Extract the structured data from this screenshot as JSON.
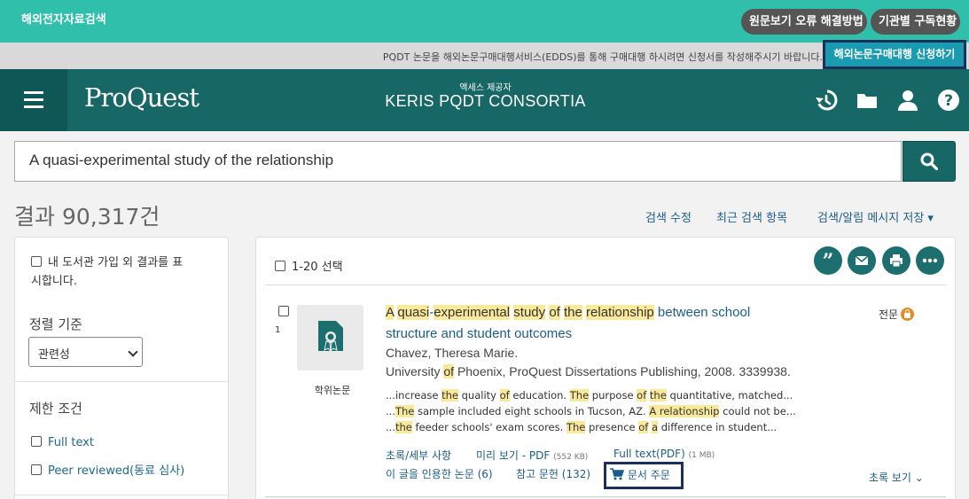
{
  "topbar": {
    "site_title": "해외전자자료검색",
    "pill_error": "원문보기 오류 해결방법",
    "pill_subscription": "기관별 구독현황"
  },
  "notice": {
    "text": "PQDT 논문을 해외논문구매대행서비스(EDDS)를 통해 구매대행 하시려면 신청서를 작성해주시기 바랍니다.",
    "order_button": "해외논문구매대행 신청하기"
  },
  "header": {
    "logo": "ProQuest",
    "provider_label": "액세스 제공자",
    "provider_name": "KERIS PQDT CONSORTIA",
    "icons": [
      "history-icon",
      "folder-icon",
      "user-icon",
      "help-icon"
    ]
  },
  "search": {
    "query": "A quasi-experimental study of the relationship"
  },
  "results": {
    "count": "결과 90,317건",
    "links": [
      "검색 수정",
      "최근 검색 항목",
      "검색/알림 메시지 저장 ▾"
    ]
  },
  "left": {
    "include_outside": "내 도서관 가입 외 결과를 표시합니다.",
    "include_outside_line1": "내 도서관 가입 외 결과를 표",
    "include_outside_line2": "시합니다.",
    "sort_label": "정렬 기준",
    "sort_value": "관련성",
    "limit_label": "제한 조건",
    "filters": [
      "Full text",
      "Peer reviewed(동료 심사)"
    ]
  },
  "list": {
    "select_label": "1-20 선택",
    "actions": [
      "cite-icon",
      "email-icon",
      "print-icon",
      "more-icon"
    ]
  },
  "item": {
    "number": "1",
    "type_label": "학위논문",
    "title_rest_line1": "between school",
    "title_line2": "structure and student outcomes",
    "author": "Chavez, Theresa Marie.",
    "pub_pre": "University",
    "pub_of": "of",
    "pub_post": "Phoenix, ProQuest Dissertations Publishing, 2008. 3339938.",
    "snippets": {
      "s1": [
        "...increase",
        "the",
        "quality",
        "of",
        "education.",
        "The",
        "purpose",
        "of",
        "the",
        "quantitative, matched..."
      ],
      "s2": [
        "...",
        "The",
        "sample included eight schools in Tucson, AZ.",
        "A relationship",
        "could not be..."
      ],
      "s3": [
        "...",
        "the",
        "feeder schools' exam scores.",
        "The",
        "presence",
        "of",
        "a",
        "difference in student..."
      ]
    },
    "fulltext_label": "전문",
    "links": {
      "abstract": "초록/세부 사항",
      "preview": "미리 보기 - PDF",
      "preview_size": "(552 KB)",
      "fulltext_pdf": "Full text(PDF)",
      "fulltext_size": "(1 MB)",
      "cited_by": "이 글을 인용한 논문 (6)",
      "references": "참고 문헌 (132)",
      "order": "문서 주문",
      "abstract_view": "초록 보기 ⌄"
    }
  },
  "colors": {
    "topbar": "#2fbfaa",
    "header": "#176767",
    "highlight": "#fbe99a",
    "link": "#1b5d8a"
  }
}
